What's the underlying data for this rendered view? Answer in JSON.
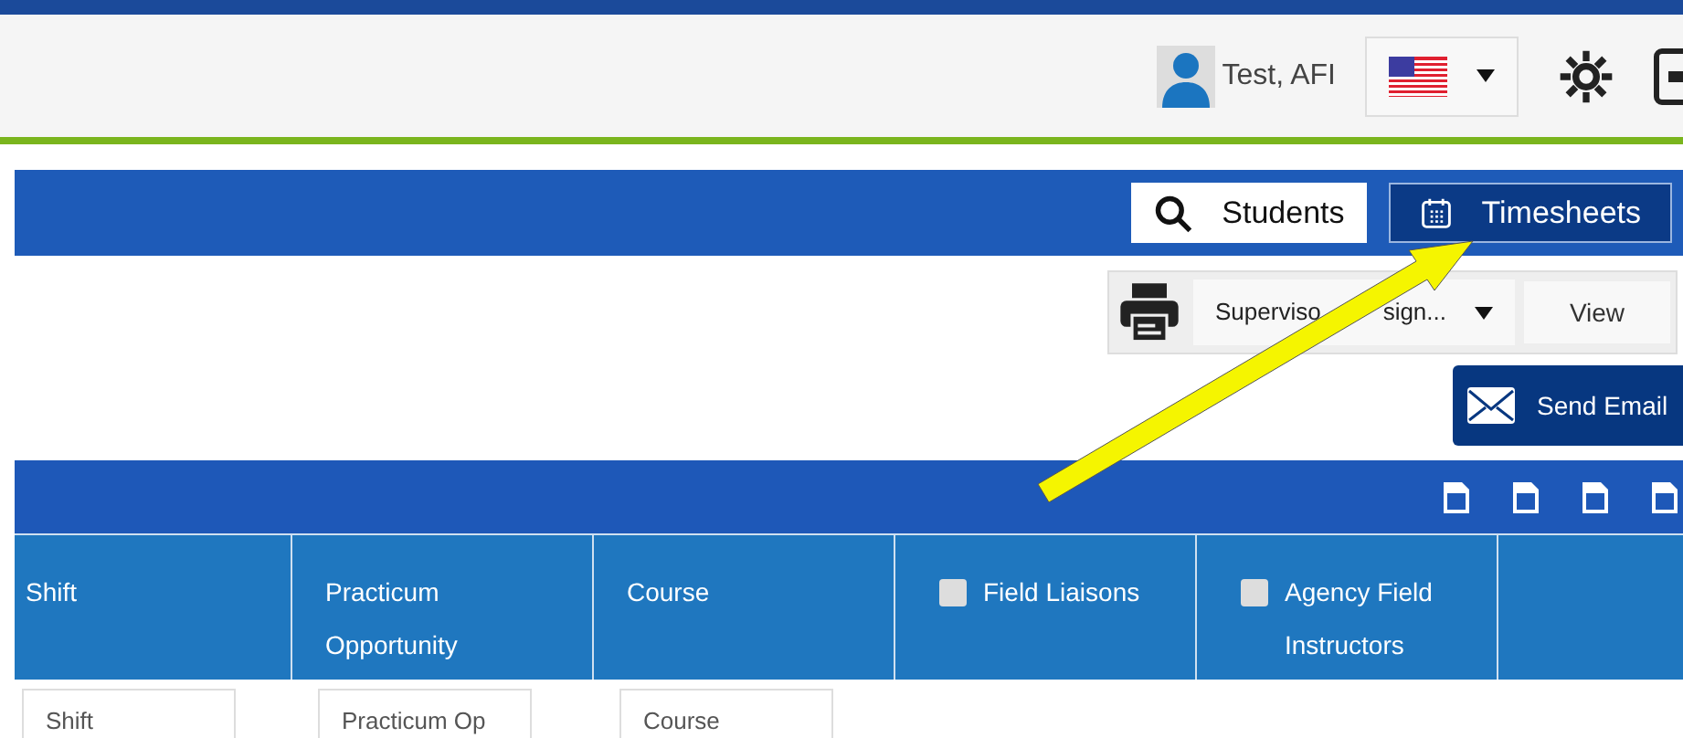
{
  "header": {
    "user_name": "Test, AFI"
  },
  "nav_buttons": [
    {
      "label": "Students",
      "selected": false
    },
    {
      "label": "Timesheets",
      "selected": true
    }
  ],
  "report_select": {
    "visible_parts": [
      "Superviso",
      "sign..."
    ]
  },
  "view_button": "View",
  "send_email_button": "Send Email",
  "columns": [
    {
      "label": "Shift",
      "kind": "text",
      "filter_placeholder": "Shift"
    },
    {
      "label": "Practicum Opportunity",
      "kind": "text",
      "filter_placeholder": "Practicum Op"
    },
    {
      "label": "Course",
      "kind": "text",
      "filter_placeholder": "Course"
    },
    {
      "label": "Field Liaisons",
      "kind": "checkbox",
      "checked": false
    },
    {
      "label": "Agency Field Instructors",
      "kind": "checkbox",
      "checked": false
    }
  ]
}
